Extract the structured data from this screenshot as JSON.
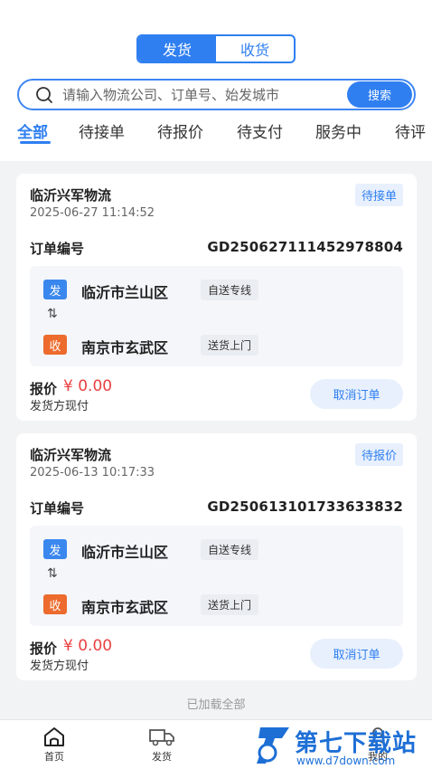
{
  "segmented": {
    "send_label": "发货",
    "receive_label": "收货"
  },
  "search": {
    "placeholder": "请输入物流公司、订单号、始发城市",
    "button_label": "搜索"
  },
  "tabs": [
    {
      "label": "全部"
    },
    {
      "label": "待接单"
    },
    {
      "label": "待报价"
    },
    {
      "label": "待支付"
    },
    {
      "label": "服务中"
    },
    {
      "label": "待评"
    }
  ],
  "orders": [
    {
      "company": "临沂兴军物流",
      "time": "2025-06-27 11:14:52",
      "status": "待接单",
      "order_label": "订单编号",
      "order_no": "GD250627111452978804",
      "from_badge": "发",
      "from_city": "临沂市兰山区",
      "from_service": "自送专线",
      "arrow": "⇅",
      "to_badge": "收",
      "to_city": "南京市玄武区",
      "to_service": "送货上门",
      "price_label": "报价",
      "price": "¥ 0.00",
      "payment": "发货方现付",
      "cancel_label": "取消订单"
    },
    {
      "company": "临沂兴军物流",
      "time": "2025-06-13 10:17:33",
      "status": "待报价",
      "order_label": "订单编号",
      "order_no": "GD250613101733633832",
      "from_badge": "发",
      "from_city": "临沂市兰山区",
      "from_service": "自送专线",
      "arrow": "⇅",
      "to_badge": "收",
      "to_city": "南京市玄武区",
      "to_service": "送货上门",
      "price_label": "报价",
      "price": "¥ 0.00",
      "payment": "发货方现付",
      "cancel_label": "取消订单"
    }
  ],
  "footer_text": "已加载全部",
  "nav": {
    "home_label": "首页",
    "ship_label": "发货",
    "mine_label": "我的"
  },
  "watermark": {
    "title": "第七下载站",
    "url": "www.d7down.com"
  },
  "colors": {
    "primary": "#2f7ff1",
    "price": "#e94040",
    "receive_badge": "#ec6b2d",
    "send_badge": "#3a87ee"
  }
}
